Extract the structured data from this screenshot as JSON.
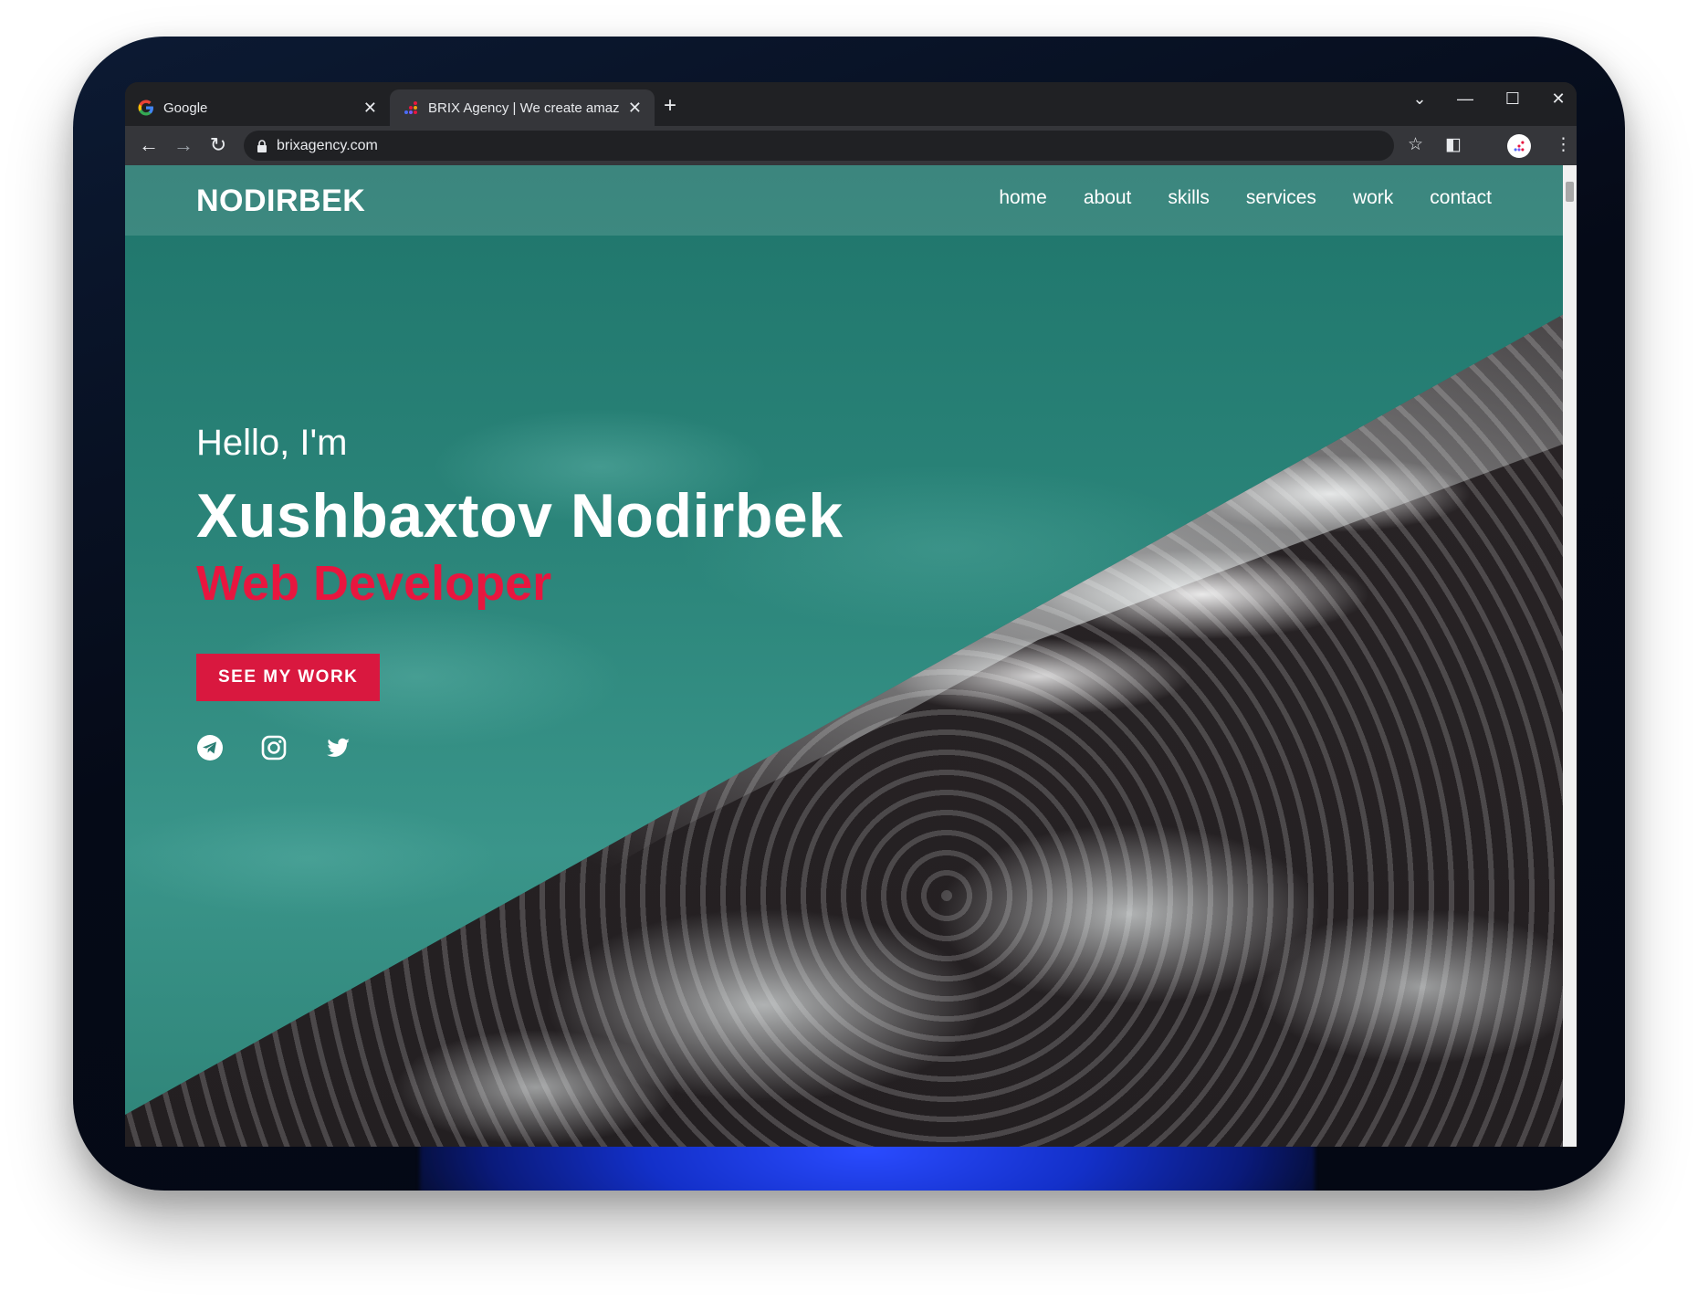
{
  "browser": {
    "tabs": [
      {
        "title": "Google",
        "active": false,
        "favicon": "google-favicon"
      },
      {
        "title": "BRIX Agency | We create amazi",
        "active": true,
        "favicon": "brix-favicon"
      }
    ],
    "new_tab_symbol": "+",
    "url": "brixagency.com",
    "window_controls": {
      "tab_search": "⌄",
      "minimize": "—",
      "maximize": "☐",
      "close": "✕"
    }
  },
  "site": {
    "logo": "NODIRBEK",
    "nav": [
      "home",
      "about",
      "skills",
      "services",
      "work",
      "contact"
    ],
    "hero": {
      "greeting": "Hello, I'm",
      "name": "Xushbaxtov Nodirbek",
      "role": "Web Developer",
      "cta_label": "SEE MY WORK"
    },
    "socials": [
      "telegram-icon",
      "instagram-icon",
      "twitter-icon"
    ],
    "colors": {
      "teal": "#2a7d73",
      "accent": "#d9183f",
      "role_text": "#e8163f"
    }
  }
}
